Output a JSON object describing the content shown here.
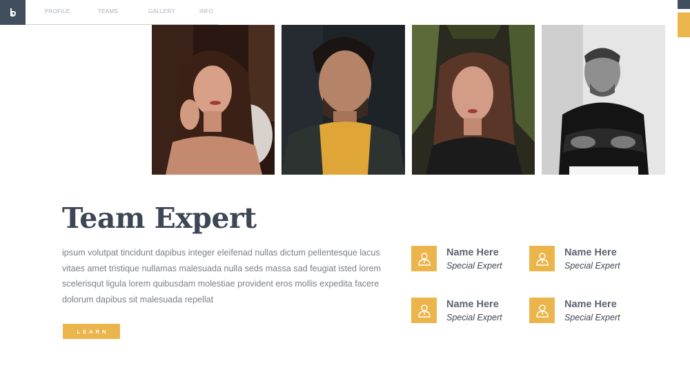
{
  "nav": {
    "items": [
      "PROFILE",
      "TEAMS",
      "GALLERY",
      "INFO"
    ]
  },
  "logo": {
    "icon": "leaf-logo-icon"
  },
  "colors": {
    "accent": "#ecb54b",
    "dark": "#3f4d5d",
    "text": "#3d4654",
    "muted": "#7b8088"
  },
  "main": {
    "title": "Team Expert",
    "body": "ipsum volutpat tincidunt dapibus integer eleifenad nullas dictum pellentesque lacus vitaes amet tristique nullamas malesuada nulla seds massa sad feugiat isted lorem scelerisqut ligula lorem quibusdam molestiae provident eros mollis expedita facere dolorum dapibus sit malesuada repellat",
    "button": "LEARN"
  },
  "experts": [
    {
      "name": "Name Here",
      "role": "Special Expert",
      "icon": "person-icon"
    },
    {
      "name": "Name Here",
      "role": "Special Expert",
      "icon": "person-icon"
    },
    {
      "name": "Name Here",
      "role": "Special Expert",
      "icon": "person-icon"
    },
    {
      "name": "Name Here",
      "role": "Special Expert",
      "icon": "person-icon"
    }
  ],
  "photos": [
    "woman-portrait",
    "man-portrait",
    "woman-ferns-portrait",
    "man-bw-portrait"
  ]
}
